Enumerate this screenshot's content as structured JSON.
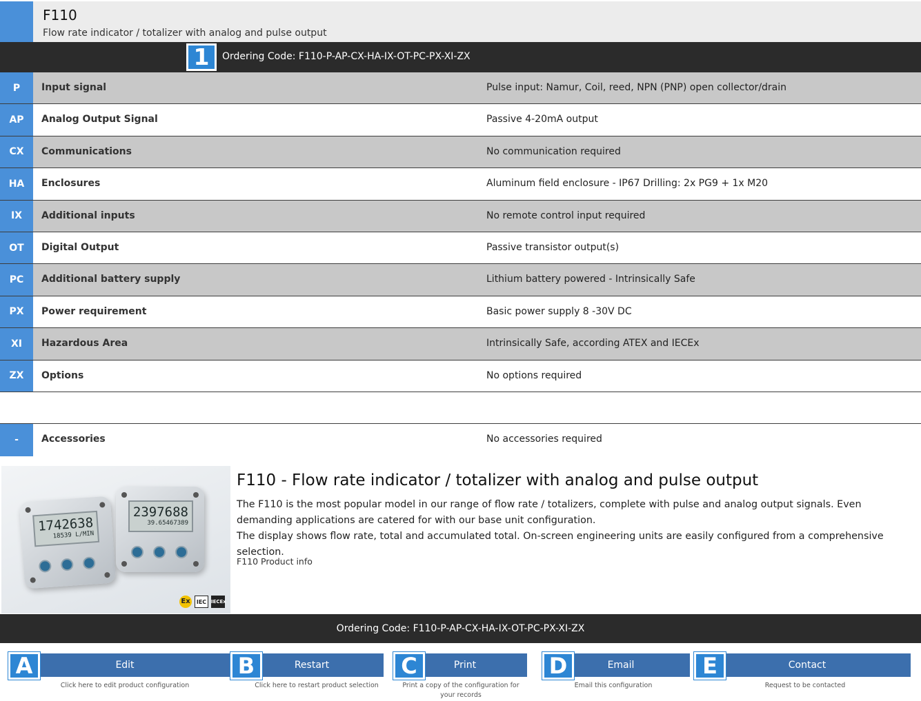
{
  "header": {
    "title": "F110",
    "subtitle": "Flow rate indicator / totalizer with analog and pulse output"
  },
  "ordering": {
    "badge": "1",
    "code_label": "Ordering Code: F110-P-AP-CX-HA-IX-OT-PC-PX-XI-ZX"
  },
  "config_rows": [
    {
      "code": "P",
      "label": "Input signal",
      "value": "Pulse input: Namur, Coil, reed, NPN (PNP) open collector/drain"
    },
    {
      "code": "AP",
      "label": "Analog Output Signal",
      "value": "Passive 4-20mA output"
    },
    {
      "code": "CX",
      "label": "Communications",
      "value": "No communication required"
    },
    {
      "code": "HA",
      "label": "Enclosures",
      "value": "Aluminum field enclosure - IP67 Drilling: 2x PG9 + 1x M20"
    },
    {
      "code": "IX",
      "label": "Additional inputs",
      "value": "No remote control input required"
    },
    {
      "code": "OT",
      "label": "Digital Output",
      "value": "Passive transistor output(s)"
    },
    {
      "code": "PC",
      "label": "Additional battery supply",
      "value": "Lithium battery powered - Intrinsically Safe"
    },
    {
      "code": "PX",
      "label": "Power requirement",
      "value": "Basic power supply 8 -30V DC"
    },
    {
      "code": "XI",
      "label": "Hazardous Area",
      "value": "Intrinsically Safe, according ATEX and IECEx"
    },
    {
      "code": "ZX",
      "label": "Options",
      "value": "No options required"
    }
  ],
  "accessories": {
    "code": "-",
    "label": "Accessories",
    "value": "No accessories required"
  },
  "product": {
    "title": "F110 - Flow rate indicator / totalizer with analog and pulse output",
    "desc_1": "The F110 is the most popular model in our range of flow rate / totalizers, complete with pulse and analog output signals. Even demanding applications are catered for with our base unit configuration.",
    "desc_2": "The display shows flow rate, total and accumulated total. On-screen engineering units are easily configured from a comprehensive selection.",
    "link": "F110 Product info",
    "image": {
      "device_left_main": "1742638",
      "device_left_sub": "18539 L/MIN",
      "device_right_main": "2397688",
      "device_right_sub": "39.65467389",
      "cert_ex": "Ex",
      "cert_iec": "IEC",
      "cert_iecex": "IECEx"
    }
  },
  "footer": {
    "code_label": "Ordering Code: F110-P-AP-CX-HA-IX-OT-PC-PX-XI-ZX"
  },
  "actions": [
    {
      "letter": "A",
      "label": "Edit",
      "hint": "Click here to edit product configuration"
    },
    {
      "letter": "B",
      "label": "Restart",
      "hint": "Click here to restart product selection"
    },
    {
      "letter": "C",
      "label": "Print",
      "hint": "Print a copy of the configuration for your records"
    },
    {
      "letter": "D",
      "label": "Email",
      "hint": "Email this configuration"
    },
    {
      "letter": "E",
      "label": "Contact",
      "hint": "Request to be contacted"
    }
  ],
  "colors": {
    "accent_blue": "#4a90d9",
    "badge_blue": "#2d86d4",
    "button_blue": "#3c6fad",
    "dark_bar": "#2b2b2b",
    "row_gray": "#c8c8c8"
  }
}
